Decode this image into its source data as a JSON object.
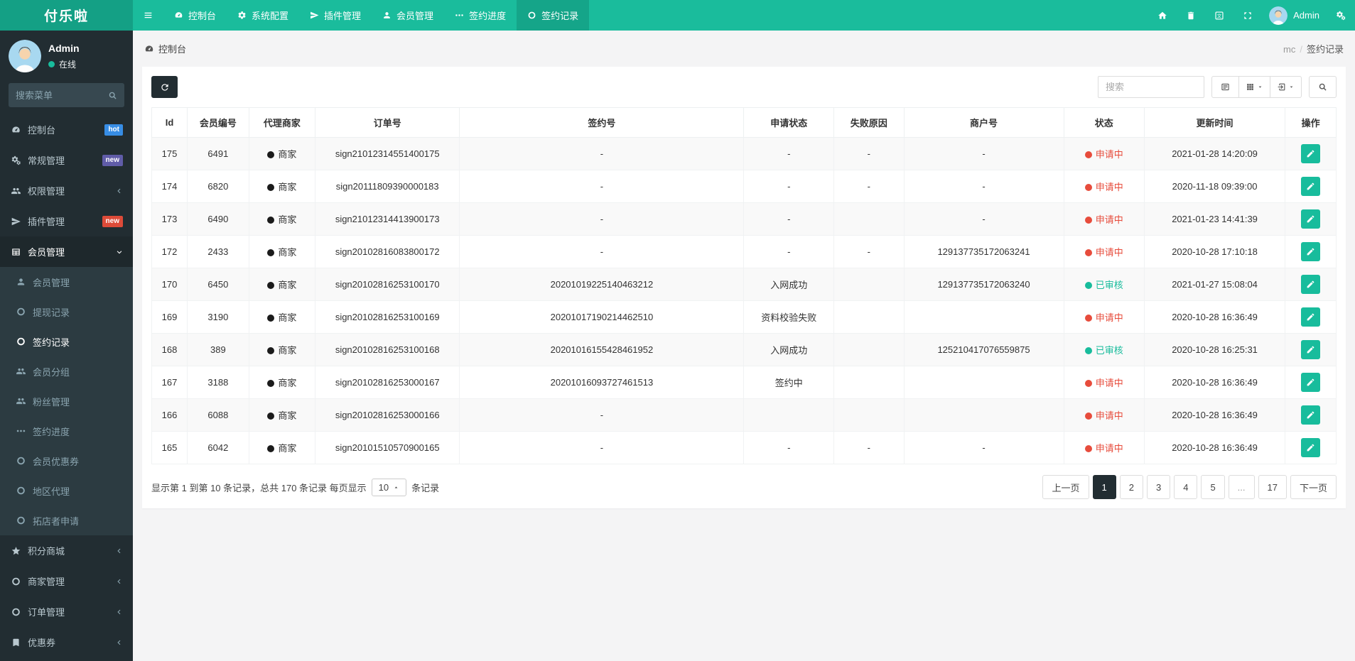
{
  "brand": {
    "logo_text": "付乐啦"
  },
  "navbar": {
    "items": [
      {
        "label": "控制台",
        "icon": "dashboard",
        "active": false
      },
      {
        "label": "系统配置",
        "icon": "gear",
        "active": false
      },
      {
        "label": "插件管理",
        "icon": "send",
        "active": false
      },
      {
        "label": "会员管理",
        "icon": "user",
        "active": false
      },
      {
        "label": "签约进度",
        "icon": "ellipsis",
        "active": false
      },
      {
        "label": "签约记录",
        "icon": "circle",
        "active": true
      }
    ],
    "right_icons": [
      "home",
      "trash",
      "language",
      "expand"
    ],
    "user": {
      "name": "Admin"
    }
  },
  "sidebar": {
    "user": {
      "name": "Admin",
      "status": "在线"
    },
    "search_placeholder": "搜索菜单",
    "menu": [
      {
        "label": "控制台",
        "icon": "dashboard",
        "badge": "hot",
        "badge_color": "#378de5"
      },
      {
        "label": "常规管理",
        "icon": "cogs",
        "badge": "new",
        "badge_color": "#605ca8"
      },
      {
        "label": "权限管理",
        "icon": "users",
        "arrow": "left"
      },
      {
        "label": "插件管理",
        "icon": "send",
        "badge": "new",
        "badge_color": "#dd4b39"
      },
      {
        "label": "会员管理",
        "icon": "table",
        "arrow": "down",
        "active": true,
        "children": [
          {
            "label": "会员管理",
            "icon": "user"
          },
          {
            "label": "提现记录",
            "icon": "circle"
          },
          {
            "label": "签约记录",
            "icon": "circle",
            "active": true
          },
          {
            "label": "会员分组",
            "icon": "users"
          },
          {
            "label": "粉丝管理",
            "icon": "users"
          },
          {
            "label": "签约进度",
            "icon": "ellipsis"
          },
          {
            "label": "会员优惠券",
            "icon": "circle"
          },
          {
            "label": "地区代理",
            "icon": "circle"
          },
          {
            "label": "拓店者申请",
            "icon": "circle"
          }
        ]
      },
      {
        "label": "积分商城",
        "icon": "star",
        "arrow": "left"
      },
      {
        "label": "商家管理",
        "icon": "circle",
        "arrow": "left"
      },
      {
        "label": "订单管理",
        "icon": "circle",
        "arrow": "left"
      },
      {
        "label": "优惠券",
        "icon": "bookmark",
        "arrow": "left"
      }
    ]
  },
  "breadcrumb": {
    "left_label": "控制台",
    "parent": "mc",
    "current": "签约记录"
  },
  "toolbar": {
    "search_placeholder": "搜索"
  },
  "table": {
    "columns": [
      "Id",
      "会员编号",
      "代理商家",
      "订单号",
      "签约号",
      "申请状态",
      "失败原因",
      "商户号",
      "状态",
      "更新时间",
      "操作"
    ],
    "rows": [
      {
        "id": "175",
        "member": "6491",
        "agent": "商家",
        "order": "sign21012314551400175",
        "sign": "-",
        "apply": "-",
        "fail": "-",
        "mch": "-",
        "status": "申请中",
        "status_type": "red",
        "time": "2021-01-28 14:20:09"
      },
      {
        "id": "174",
        "member": "6820",
        "agent": "商家",
        "order": "sign20111809390000183",
        "sign": "-",
        "apply": "-",
        "fail": "-",
        "mch": "-",
        "status": "申请中",
        "status_type": "red",
        "time": "2020-11-18 09:39:00"
      },
      {
        "id": "173",
        "member": "6490",
        "agent": "商家",
        "order": "sign21012314413900173",
        "sign": "-",
        "apply": "-",
        "fail": "",
        "mch": "-",
        "status": "申请中",
        "status_type": "red",
        "time": "2021-01-23 14:41:39"
      },
      {
        "id": "172",
        "member": "2433",
        "agent": "商家",
        "order": "sign20102816083800172",
        "sign": "-",
        "apply": "-",
        "fail": "-",
        "mch": "129137735172063241",
        "status": "申请中",
        "status_type": "red",
        "time": "2020-10-28 17:10:18"
      },
      {
        "id": "170",
        "member": "6450",
        "agent": "商家",
        "order": "sign20102816253100170",
        "sign": "20201019225140463212",
        "apply": "入网成功",
        "fail": "",
        "mch": "129137735172063240",
        "status": "已审核",
        "status_type": "green",
        "time": "2021-01-27 15:08:04"
      },
      {
        "id": "169",
        "member": "3190",
        "agent": "商家",
        "order": "sign20102816253100169",
        "sign": "20201017190214462510",
        "apply": "资料校验失败",
        "fail": "",
        "mch": "",
        "status": "申请中",
        "status_type": "red",
        "time": "2020-10-28 16:36:49"
      },
      {
        "id": "168",
        "member": "389",
        "agent": "商家",
        "order": "sign20102816253100168",
        "sign": "20201016155428461952",
        "apply": "入网成功",
        "fail": "",
        "mch": "125210417076559875",
        "status": "已审核",
        "status_type": "green",
        "time": "2020-10-28 16:25:31"
      },
      {
        "id": "167",
        "member": "3188",
        "agent": "商家",
        "order": "sign20102816253000167",
        "sign": "20201016093727461513",
        "apply": "签约中",
        "fail": "",
        "mch": "",
        "status": "申请中",
        "status_type": "red",
        "time": "2020-10-28 16:36:49"
      },
      {
        "id": "166",
        "member": "6088",
        "agent": "商家",
        "order": "sign20102816253000166",
        "sign": "-",
        "apply": "",
        "fail": "",
        "mch": "",
        "status": "申请中",
        "status_type": "red",
        "time": "2020-10-28 16:36:49"
      },
      {
        "id": "165",
        "member": "6042",
        "agent": "商家",
        "order": "sign20101510570900165",
        "sign": "-",
        "apply": "-",
        "fail": "-",
        "mch": "-",
        "status": "申请中",
        "status_type": "red",
        "time": "2020-10-28 16:36:49"
      }
    ]
  },
  "footer": {
    "summary_prefix": "显示第 1 到第 10 条记录，总共 170 条记录 每页显示",
    "page_size": "10",
    "summary_suffix": "条记录",
    "pagination": [
      "上一页",
      "1",
      "2",
      "3",
      "4",
      "5",
      "...",
      "17",
      "下一页"
    ],
    "active_page": "1"
  },
  "colors": {
    "navbar": "#1abc9c",
    "navbar_logo": "#14a085",
    "navbar_active": "#15a589",
    "sidebar": "#222d32",
    "submenu": "#2c3b41",
    "accent": "#18bc9c",
    "status_red": "#e74c3c",
    "status_green": "#18bc9c",
    "dark_button": "#222d32"
  }
}
